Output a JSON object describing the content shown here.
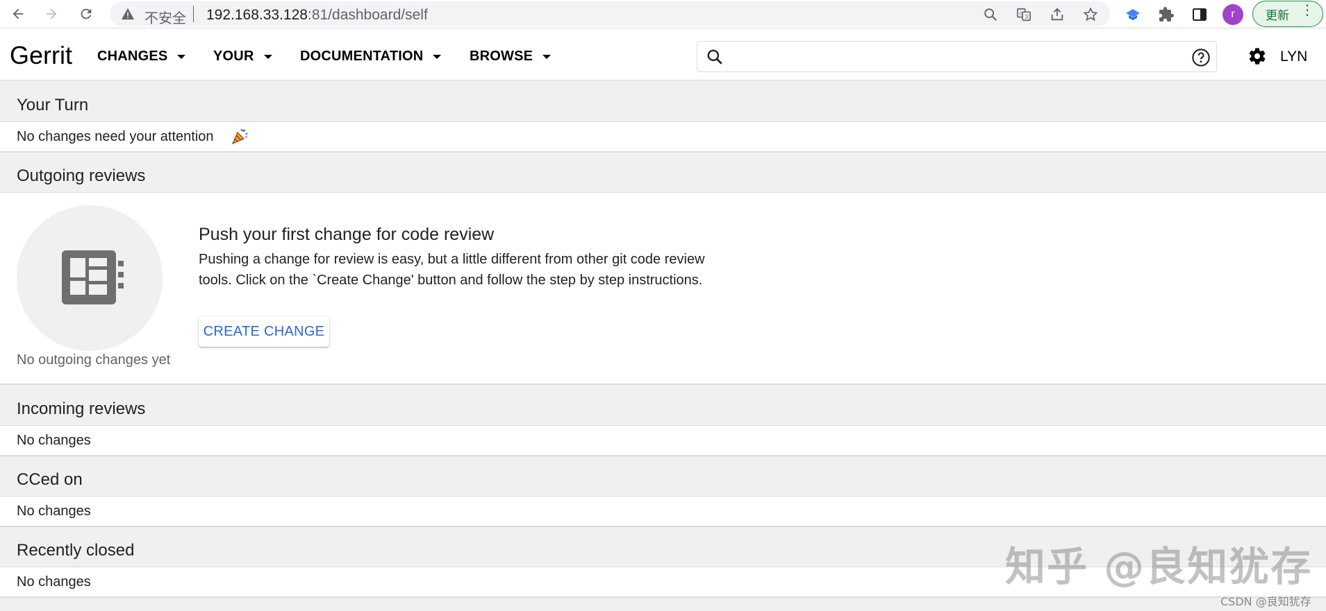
{
  "browser": {
    "security_label": "不安全",
    "url_host": "192.168.33.128",
    "url_rest": ":81/dashboard/self",
    "profile_initial": "r",
    "update_label": "更新"
  },
  "header": {
    "logo": "Gerrit",
    "menus": [
      {
        "label": "CHANGES"
      },
      {
        "label": "YOUR"
      },
      {
        "label": "DOCUMENTATION"
      },
      {
        "label": "BROWSE"
      }
    ],
    "search_value": "",
    "user": "LYN"
  },
  "sections": {
    "your_turn": {
      "title": "Your Turn",
      "message": "No changes need your attention"
    },
    "outgoing": {
      "title": "Outgoing reviews",
      "empty_caption": "No outgoing changes yet",
      "push_title": "Push your first change for code review",
      "push_desc": "Pushing a change for review is easy, but a little different from other git code review tools. Click on the `Create Change' button and follow the step by step instructions.",
      "create_button": "CREATE CHANGE"
    },
    "incoming": {
      "title": "Incoming reviews",
      "message": "No changes"
    },
    "cced": {
      "title": "CCed on",
      "message": "No changes"
    },
    "recently_closed": {
      "title": "Recently closed",
      "message": "No changes"
    }
  },
  "watermark": {
    "large": "知乎 @良知犹存",
    "small": "CSDN @良知犹存"
  }
}
